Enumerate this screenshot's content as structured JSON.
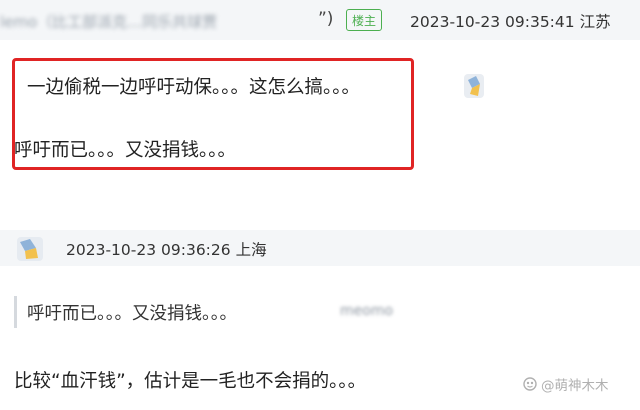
{
  "comment1": {
    "username_blurred": "lemo（比工部派克…同乐共球贾",
    "quote_end": "”)",
    "op_badge": "楼主",
    "timestamp": "2023-10-23 09:35:41",
    "location": "江苏",
    "line1": "一边偷税一边呼吁动保。。。这怎么搞。。。",
    "line2": "呼吁而已。。。又没捐钱。。。"
  },
  "comment2": {
    "timestamp": "2023-10-23 09:36:26",
    "location": "上海",
    "quote_text": "呼吁而已。。。又没捐钱。。。",
    "quote_user_blurred": "meomo",
    "body": "比较“血汗钱”，估计是一毛也不会捐的。。。"
  },
  "watermark": {
    "text": "@萌神木木"
  },
  "colors": {
    "highlight_border": "#e02424",
    "badge_green": "#4caf50",
    "header_bg": "#f4f6f8"
  },
  "icons": {
    "avatar": "avatar-icon",
    "watermark_logo": "watermark-logo-icon"
  }
}
